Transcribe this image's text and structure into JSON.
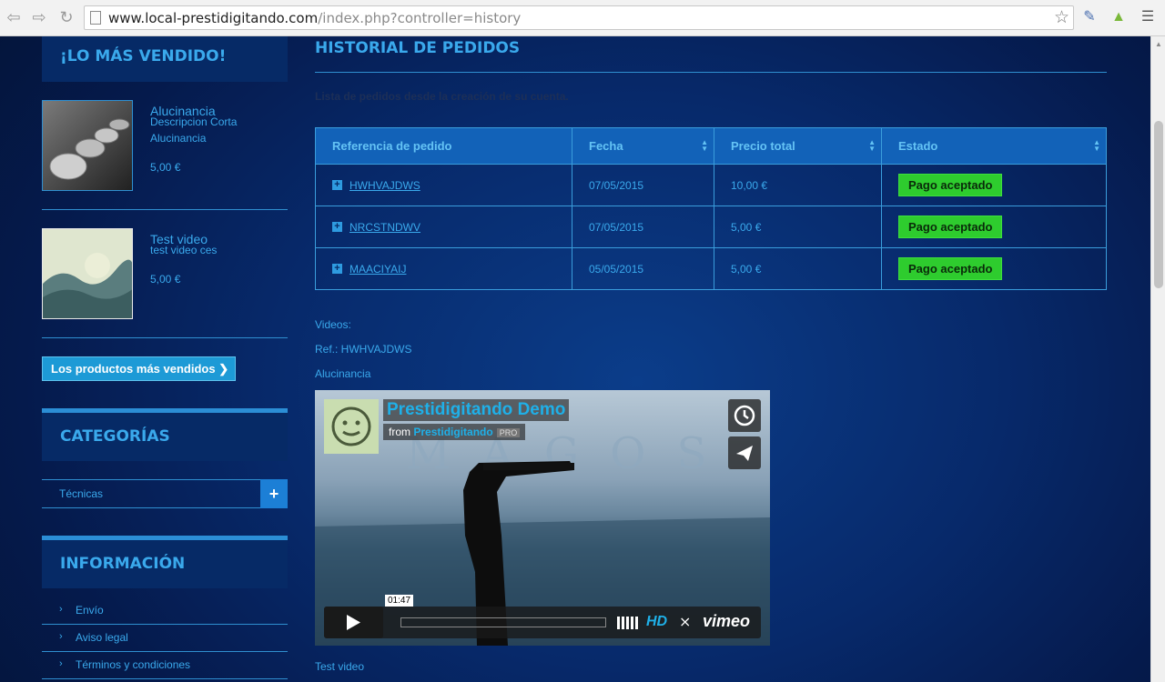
{
  "browser": {
    "url_host": "www.local-prestidigitando.com",
    "url_path": "/index.php?controller=history"
  },
  "sidebar": {
    "bestsellers_title": "¡LO MÁS VENDIDO!",
    "products": [
      {
        "name": "Alucinancia",
        "desc": "Descripcion Corta Alucinancia",
        "price": "5,00 €"
      },
      {
        "name": "Test video",
        "desc": "test video ces",
        "price": "5,00 €"
      }
    ],
    "bestsellers_button": "Los productos más vendidos",
    "categories_title": "CATEGORÍAS",
    "categories": [
      {
        "label": "Técnicas"
      }
    ],
    "info_title": "INFORMACIÓN",
    "info_items": [
      {
        "label": "Envío"
      },
      {
        "label": "Aviso legal"
      },
      {
        "label": "Términos y condiciones"
      }
    ]
  },
  "main": {
    "title": "HISTORIAL DE PEDIDOS",
    "subtitle": "Lista de pedidos desde la creación de su cuenta.",
    "table": {
      "headers": [
        "Referencia de pedido",
        "Fecha",
        "Precio total",
        "Estado"
      ],
      "rows": [
        {
          "ref": "HWHVAJDWS",
          "date": "07/05/2015",
          "total": "10,00 €",
          "status": "Pago aceptado"
        },
        {
          "ref": "NRCSTNDWV",
          "date": "07/05/2015",
          "total": "5,00 €",
          "status": "Pago aceptado"
        },
        {
          "ref": "MAACIYAIJ",
          "date": "05/05/2015",
          "total": "5,00 €",
          "status": "Pago aceptado"
        }
      ]
    },
    "videos_label": "Videos:",
    "ref_label": "Ref.: HWHVAJDWS",
    "product_label": "Alucinancia",
    "video": {
      "title": "Prestidigitando Demo",
      "from": "from",
      "channel": "Prestidigitando",
      "badge": "PRO",
      "time": "01:47",
      "hd": "HD",
      "brand": "vimeo",
      "bg_text": "MAGOS"
    },
    "next_label": "Test video"
  }
}
